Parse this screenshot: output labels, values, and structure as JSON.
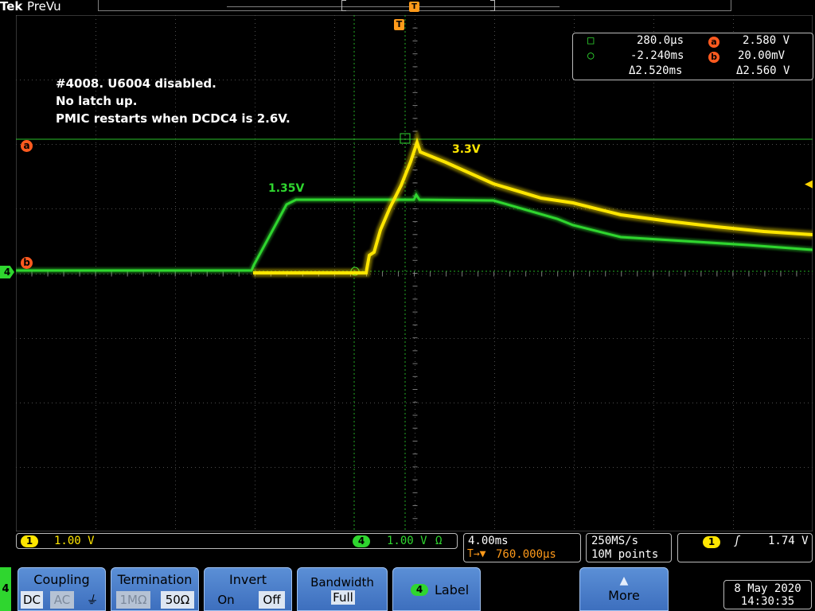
{
  "header": {
    "brand": "Tek",
    "mode": "PreVu"
  },
  "annotations": {
    "line1": "#4008. U6004 disabled.",
    "line2": "No latch up.",
    "line3": "PMIC restarts when DCDC4 is 2.6V.",
    "green_label": "1.35V",
    "yellow_label": "3.3V"
  },
  "markers": {
    "ref_a": "a",
    "ref_b": "b",
    "ch4": "4",
    "trigger": "T",
    "trigger_level": "◀"
  },
  "cursors": {
    "time_a": "280.0µs",
    "time_b": "-2.240ms",
    "time_delta": "Δ2.520ms",
    "volt_a_badge": "a",
    "volt_a": "2.580 V",
    "volt_b_badge": "b",
    "volt_b": "20.00mV",
    "volt_delta": "Δ2.560 V"
  },
  "status": {
    "ch1_badge": "1",
    "ch1_scale": "1.00 V",
    "ch4_badge": "4",
    "ch4_scale": "1.00 V",
    "ch4_term": "Ω",
    "timebase": "4.00ms",
    "trigger_pos_prefix": "T→▼",
    "trigger_pos": "760.000µs",
    "sample_rate": "250MS/s",
    "record_length": "10M points",
    "trig_badge": "1",
    "trig_slope": "ʃ",
    "trig_level": "1.74 V"
  },
  "menu": {
    "channel_tab": "4",
    "coupling": {
      "title": "Coupling",
      "dc": "DC",
      "ac": "AC",
      "gnd": "⏚"
    },
    "termination": {
      "title": "Termination",
      "1m": "1MΩ",
      "50": "50Ω"
    },
    "invert": {
      "title": "Invert",
      "on": "On",
      "off": "Off"
    },
    "bandwidth": {
      "title": "Bandwidth",
      "value": "Full"
    },
    "label": {
      "badge": "4",
      "title": "Label"
    },
    "more": {
      "arrow": "▲",
      "title": "More"
    }
  },
  "datetime": {
    "date": "8 May 2020",
    "time": "14:30:35"
  },
  "colors": {
    "ch1_yellow": "#ffe600",
    "ch4_green": "#2fd62f",
    "ref_orange": "#ff5a1f",
    "trigger_orange": "#ff9a1a",
    "menu_blue": "#4a7ec8"
  }
}
